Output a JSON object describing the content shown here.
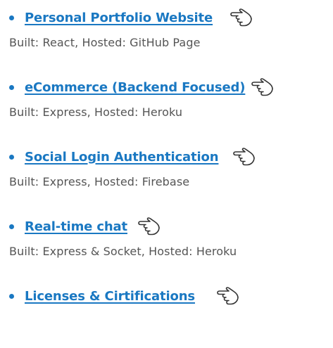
{
  "accent_color": "#1a78c2",
  "text_color": "#555555",
  "projects": [
    {
      "title": "Personal Portfolio Website",
      "description": "Built: React, Hosted: GitHub Page",
      "icon": "pointing-hand-icon"
    },
    {
      "title": "eCommerce (Backend Focused)",
      "description": "Built: Express, Hosted: Heroku",
      "icon": "pointing-hand-icon"
    },
    {
      "title": "Social Login Authentication",
      "description": "Built: Express, Hosted: Firebase",
      "icon": "pointing-hand-icon"
    },
    {
      "title": "Real-time chat",
      "description": "Built: Express & Socket, Hosted: Heroku",
      "icon": "pointing-hand-icon"
    },
    {
      "title": "Licenses & Cirtifications",
      "description": "",
      "icon": "pointing-hand-icon"
    }
  ]
}
